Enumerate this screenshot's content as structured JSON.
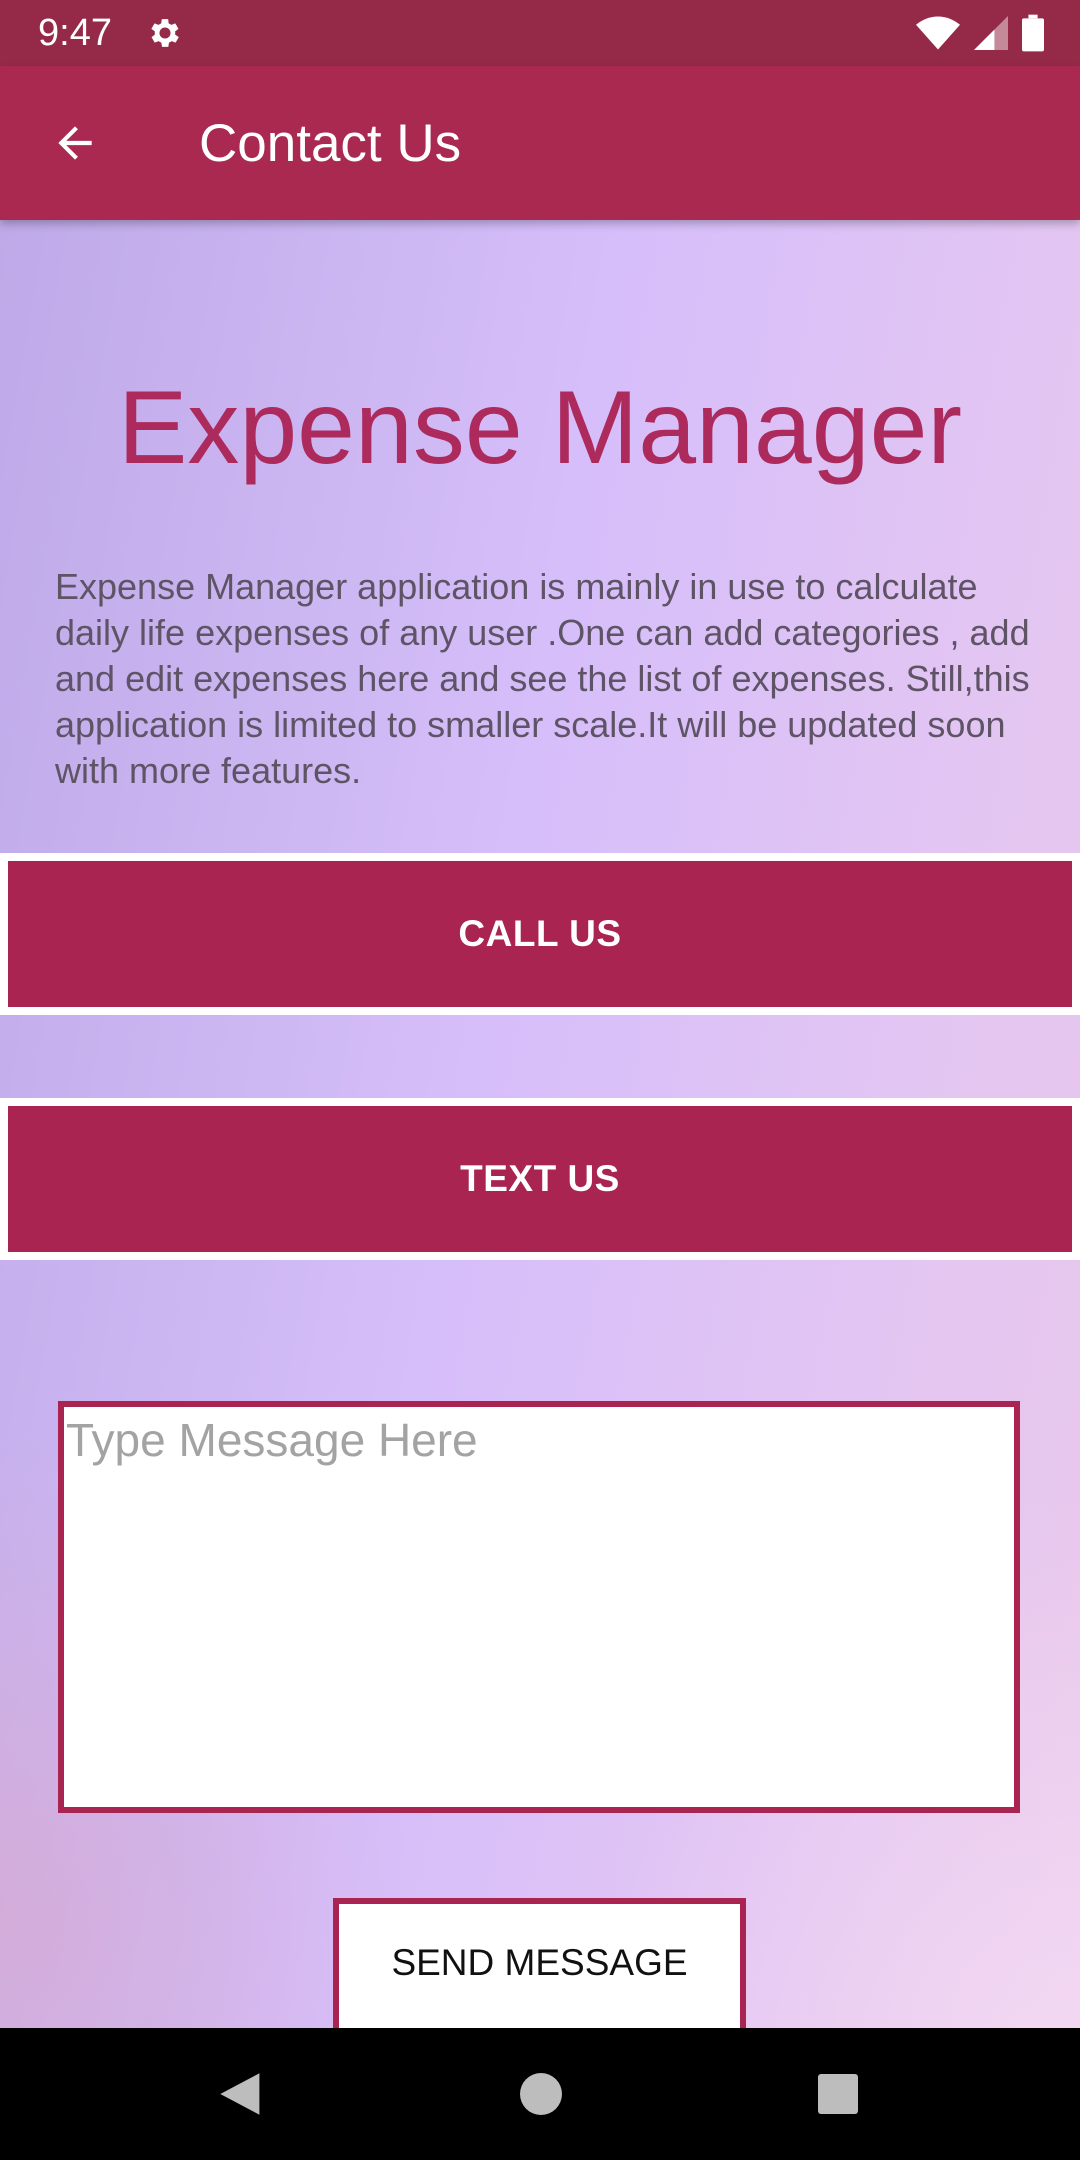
{
  "status_bar": {
    "time": "9:47",
    "icons": [
      "gear-icon",
      "wifi-icon",
      "signal-icon",
      "battery-icon"
    ]
  },
  "app_bar": {
    "title": "Contact Us",
    "back_icon": "arrow-left-icon"
  },
  "main": {
    "headline": "Expense Manager",
    "description": "Expense Manager application is mainly in use to calculate daily life expenses of any user .One can add categories , add and edit expenses here and see the list of expenses. Still,this application is limited to smaller scale.It will be updated soon with more features.",
    "call_button_label": "CALL US",
    "text_button_label": "TEXT US",
    "message": {
      "value": "",
      "placeholder": "Type Message Here"
    },
    "send_button_label": "SEND MESSAGE"
  },
  "nav_bar": {
    "icons": [
      "back-triangle-icon",
      "home-circle-icon",
      "recents-square-icon"
    ]
  },
  "colors": {
    "status_bar": "#952a48",
    "primary": "#a92950",
    "headline": "#ad2a5d",
    "description_text": "#5e5466",
    "placeholder": "#a3a3a3"
  }
}
